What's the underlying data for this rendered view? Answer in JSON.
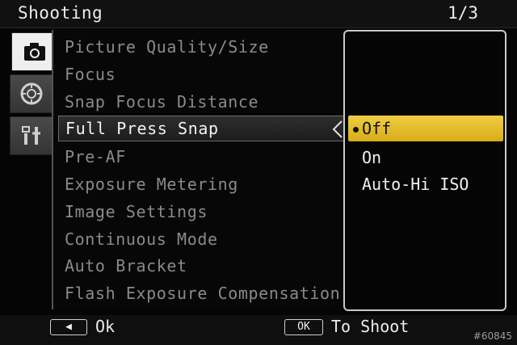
{
  "header": {
    "title": "Shooting",
    "page": "1/3"
  },
  "tabs": [
    {
      "icon": "camera-icon",
      "active": true
    },
    {
      "icon": "dial-icon",
      "active": false
    },
    {
      "icon": "wrench-icon",
      "active": false
    }
  ],
  "menu": {
    "items": [
      {
        "label": "Picture Quality/Size"
      },
      {
        "label": "Focus"
      },
      {
        "label": "Snap Focus Distance"
      },
      {
        "label": "Full Press Snap",
        "selected": true
      },
      {
        "label": "Pre-AF"
      },
      {
        "label": "Exposure Metering"
      },
      {
        "label": "Image Settings"
      },
      {
        "label": "Continuous Mode"
      },
      {
        "label": "Auto Bracket"
      },
      {
        "label": "Flash Exposure Compensation"
      }
    ]
  },
  "options": {
    "items": [
      {
        "label": "Off",
        "selected": true
      },
      {
        "label": "On"
      },
      {
        "label": "Auto-Hi ISO"
      }
    ]
  },
  "footer": {
    "back_key": "◀",
    "back_label": "Ok",
    "ok_key": "OK",
    "ok_label": "To Shoot"
  },
  "watermark": "#60845"
}
